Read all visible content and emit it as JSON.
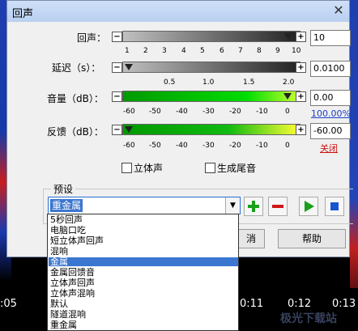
{
  "dialog": {
    "title": "回声",
    "close": "✕"
  },
  "rows": [
    {
      "label": "回声：",
      "value": "10",
      "scale": [
        "1",
        "2",
        "3",
        "4",
        "5",
        "6",
        "7",
        "8",
        "9",
        "10"
      ]
    },
    {
      "label": "延迟（s）：",
      "value": "0.0100",
      "scale": [
        "0.5",
        "1.0",
        "1.5",
        "2.0"
      ]
    },
    {
      "label": "音量（dB）：",
      "value": "0.00",
      "scale": [
        "-60",
        "-50",
        "-40",
        "-30",
        "-20",
        "-10",
        "0"
      ],
      "link": "100.00%"
    },
    {
      "label": "反馈（dB）：",
      "value": "-60.00",
      "scale": [
        "-60",
        "-50",
        "-40",
        "-30",
        "-20",
        "-10",
        "0"
      ],
      "link": "关闭"
    }
  ],
  "checks": {
    "stereo": "立体声",
    "tail": "生成尾音"
  },
  "preset": {
    "group_label": "预设",
    "selected": "重金属",
    "items": [
      "5秒回声",
      "电脑口吃",
      "短立体声回声",
      "混响",
      "金属",
      "金属回馈音",
      "立体声回声",
      "立体声混响",
      "默认",
      "隧道混响",
      "重金属"
    ],
    "highlighted_index": 4
  },
  "buttons": {
    "cancel": "消",
    "help": "帮助"
  },
  "timeline": {
    "ticks": [
      ":05",
      "0:06",
      "0:07",
      "0:08",
      "0:09",
      "0:10",
      "0:11",
      "0:12",
      "0:13"
    ]
  },
  "watermark": "极光下载站",
  "colors": {
    "accent": "#3b76d0",
    "green": "#00cc00",
    "red": "#cc1111",
    "link_blue": "#1a3ec8"
  },
  "icons": {
    "add": "plus-icon",
    "remove": "minus-icon",
    "play": "play-icon",
    "stop": "stop-icon"
  }
}
